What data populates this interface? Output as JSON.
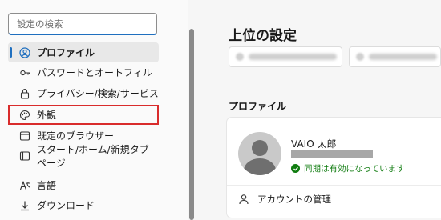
{
  "search": {
    "placeholder": "設定の検索"
  },
  "sidebar": {
    "items": [
      {
        "label": "プロファイル",
        "icon": "profile-icon",
        "active": true
      },
      {
        "label": "パスワードとオートフィル",
        "icon": "key-icon"
      },
      {
        "label": "プライバシー/検索/サービス",
        "icon": "lock-icon"
      },
      {
        "label": "外観",
        "icon": "palette-icon"
      },
      {
        "label": "既定のブラウザー",
        "icon": "browser-icon"
      },
      {
        "label": "スタート/ホーム/新規タブ ページ",
        "icon": "home-icon"
      },
      {
        "label": "言語",
        "icon": "language-icon"
      },
      {
        "label": "ダウンロード",
        "icon": "download-icon"
      }
    ]
  },
  "main": {
    "title": "上位の設定",
    "section_label": "プロファイル",
    "profile": {
      "name": "VAIO 太郎",
      "sync_status": "同期は有効になっています",
      "manage_label": "アカウントの管理"
    }
  },
  "colors": {
    "accent": "#1f6fbf",
    "highlight_border": "#d92c2c",
    "sync_green": "#107c10"
  }
}
